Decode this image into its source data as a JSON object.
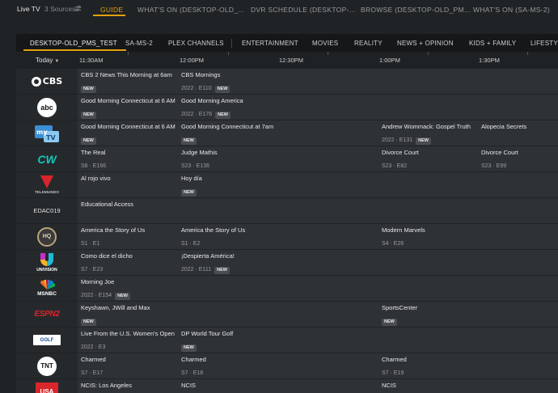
{
  "header": {
    "title": "Live TV",
    "sources": "3 Sources",
    "tabs": [
      {
        "label": "GUIDE",
        "active": true
      },
      {
        "label": "WHAT'S ON (DESKTOP-OLD_..."
      },
      {
        "label": "DVR SCHEDULE (DESKTOP-..."
      },
      {
        "label": "BROWSE (DESKTOP-OLD_PM..."
      },
      {
        "label": "WHAT'S ON (SA-MS-2)"
      }
    ]
  },
  "categories": [
    {
      "label": "DESKTOP-OLD_PMS_TEST",
      "active": true
    },
    {
      "label": "SA-MS-2"
    },
    {
      "label": "PLEX CHANNELS"
    },
    {
      "label": "ENTERTAINMENT"
    },
    {
      "label": "MOVIES"
    },
    {
      "label": "REALITY"
    },
    {
      "label": "NEWS + OPINION"
    },
    {
      "label": "KIDS + FAMILY"
    },
    {
      "label": "LIFESTYLE"
    }
  ],
  "timebar": {
    "day": "Today",
    "times": [
      "11:30AM",
      "12:00PM",
      "12:30PM",
      "1:00PM",
      "1:30PM"
    ]
  },
  "badge_new": "NEW",
  "channels": [
    {
      "logo": "CBS",
      "programs": [
        {
          "title": "CBS 2 News This Morning at 6am",
          "meta": "",
          "new": true
        },
        {
          "title": "CBS Mornings",
          "meta": "2022 · E110",
          "new": true
        }
      ]
    },
    {
      "logo": "abc",
      "programs": [
        {
          "title": "Good Morning Connecticut at 6 AM",
          "meta": "",
          "new": true
        },
        {
          "title": "Good Morning America",
          "meta": "2022 · E176",
          "new": true
        }
      ]
    },
    {
      "logo": "myTV",
      "programs": [
        {
          "title": "Good Morning Connecticut at 6 AM",
          "meta": "",
          "new": true
        },
        {
          "title": "Good Morning Connecticut at 7am",
          "meta": "",
          "new": true
        },
        {
          "title": "Andrew Wommack: Gospel Truth",
          "meta": "2022 · E131",
          "new": true
        },
        {
          "title": "Alopecia Secrets",
          "meta": "",
          "new": false
        }
      ]
    },
    {
      "logo": "CW",
      "programs": [
        {
          "title": "The Real",
          "meta": "S8 · E166",
          "new": false
        },
        {
          "title": "Judge Mathis",
          "meta": "S23 · E136",
          "new": false
        },
        {
          "title": "Divorce Court",
          "meta": "S23 · E82",
          "new": false
        },
        {
          "title": "Divorce Court",
          "meta": "S23 · E99",
          "new": false
        }
      ]
    },
    {
      "logo": "TELEMUNDO",
      "programs": [
        {
          "title": "Al rojo vivo",
          "meta": "",
          "new": false
        },
        {
          "title": "Hoy día",
          "meta": "",
          "new": true
        }
      ]
    },
    {
      "logo": "EDAC019",
      "programs": [
        {
          "title": "Educational Access",
          "meta": "",
          "new": false
        }
      ]
    },
    {
      "logo": "HQ",
      "programs": [
        {
          "title": "America the Story of Us",
          "meta": "S1 · E1",
          "new": false
        },
        {
          "title": "America the Story of Us",
          "meta": "S1 · E2",
          "new": false
        },
        {
          "title": "Modern Marvels",
          "meta": "S4 · E26",
          "new": false
        }
      ]
    },
    {
      "logo": "UNIVISION",
      "programs": [
        {
          "title": "Como dice el dicho",
          "meta": "S7 · E23",
          "new": false
        },
        {
          "title": "¡Despierta América!",
          "meta": "2022 · E111",
          "new": true
        }
      ]
    },
    {
      "logo": "MSNBC",
      "programs": [
        {
          "title": "Morning Joe",
          "meta": "2022 · E154",
          "new": true
        }
      ]
    },
    {
      "logo": "ESPN2",
      "programs": [
        {
          "title": "Keyshawn, JWill and Max",
          "meta": "",
          "new": true
        },
        {
          "title": "SportsCenter",
          "meta": "",
          "new": true
        }
      ]
    },
    {
      "logo": "GOLF",
      "programs": [
        {
          "title": "Live From the U.S. Women's Open",
          "meta": "2022 · E3",
          "new": false
        },
        {
          "title": "DP World Tour Golf",
          "meta": "",
          "new": true
        }
      ]
    },
    {
      "logo": "TNT",
      "programs": [
        {
          "title": "Charmed",
          "meta": "S7 · E17",
          "new": false
        },
        {
          "title": "Charmed",
          "meta": "S7 · E18",
          "new": false
        },
        {
          "title": "Charmed",
          "meta": "S7 · E19",
          "new": false
        }
      ]
    },
    {
      "logo": "USA",
      "programs": [
        {
          "title": "NCIS: Los Angeles",
          "meta": "",
          "new": false
        },
        {
          "title": "NCIS",
          "meta": "",
          "new": false
        },
        {
          "title": "NCIS",
          "meta": "",
          "new": false
        }
      ]
    }
  ]
}
